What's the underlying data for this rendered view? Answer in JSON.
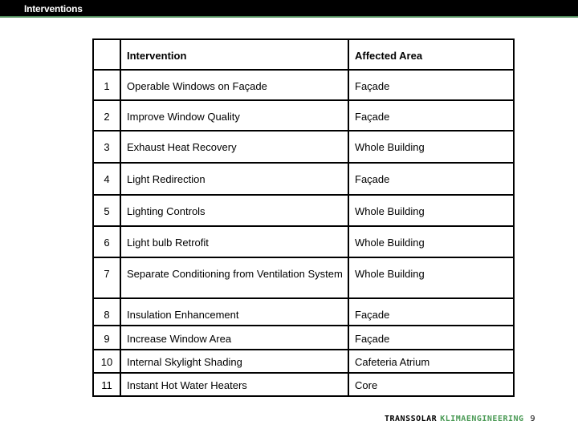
{
  "header": {
    "title": "Interventions"
  },
  "table": {
    "columns": [
      "",
      "Intervention",
      "Affected Area"
    ],
    "rows": [
      {
        "num": "1",
        "intervention": "Operable Windows on Façade",
        "area": "Façade"
      },
      {
        "num": "2",
        "intervention": "Improve Window Quality",
        "area": "Façade"
      },
      {
        "num": "3",
        "intervention": "Exhaust Heat Recovery",
        "area": "Whole Building"
      },
      {
        "num": "4",
        "intervention": "Light Redirection",
        "area": "Façade"
      },
      {
        "num": "5",
        "intervention": "Lighting Controls",
        "area": "Whole Building"
      },
      {
        "num": "6",
        "intervention": "Light bulb Retrofit",
        "area": "Whole Building"
      },
      {
        "num": "7",
        "intervention": "Separate Conditioning from Ventilation System",
        "area": "Whole Building"
      },
      {
        "num": "8",
        "intervention": "Insulation Enhancement",
        "area": "Façade"
      },
      {
        "num": "9",
        "intervention": "Increase Window Area",
        "area": "Façade"
      },
      {
        "num": "10",
        "intervention": "Internal Skylight Shading",
        "area": "Cafeteria Atrium"
      },
      {
        "num": "11",
        "intervention": "Instant Hot Water Heaters",
        "area": "Core"
      }
    ]
  },
  "footer": {
    "brand_primary": "TRANSSOLAR",
    "brand_secondary": "KLIMAENGINEERING",
    "page_number": "9"
  },
  "colors": {
    "header_bg": "#000000",
    "header_accent": "#4f8a5a",
    "brand_green": "#4a9a55"
  }
}
